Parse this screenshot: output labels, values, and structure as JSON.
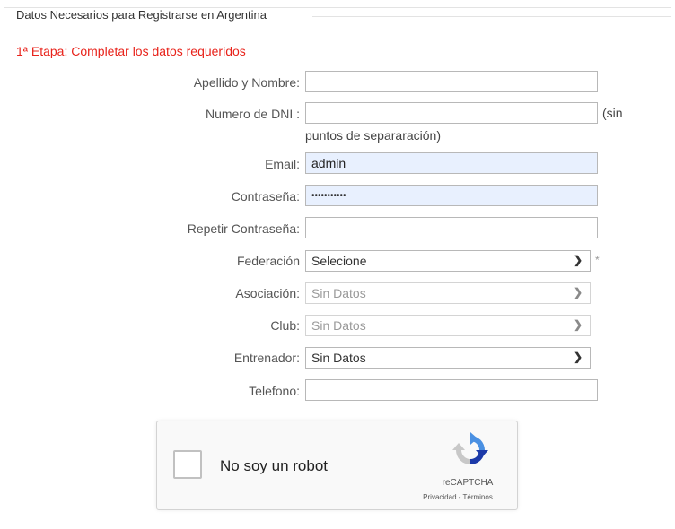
{
  "form": {
    "legend": "Datos Necesarios para Registrarse en Argentina",
    "stage_title": "1ª Etapa: Completar los datos  requeridos",
    "fields": {
      "apellido_nombre": {
        "label": "Apellido y Nombre:",
        "value": ""
      },
      "dni": {
        "label": "Numero de DNI :",
        "value": "",
        "hint_a": "(sin",
        "hint_b": "puntos de separaración)"
      },
      "email": {
        "label": "Email:",
        "value": "admin"
      },
      "contrasena": {
        "label": "Contraseña:",
        "value": "•••••••••••"
      },
      "repetir_contrasena": {
        "label": "Repetir Contraseña:",
        "value": ""
      },
      "federacion": {
        "label": "Federación",
        "selected": "Selecione",
        "required_mark": "*"
      },
      "asociacion": {
        "label": "Asociación:",
        "selected": "Sin Datos"
      },
      "club": {
        "label": "Club:",
        "selected": "Sin Datos"
      },
      "entrenador": {
        "label": "Entrenador:",
        "selected": "Sin Datos"
      },
      "telefono": {
        "label": "Telefono:",
        "value": ""
      }
    }
  },
  "recaptcha": {
    "label": "No soy un robot",
    "brand": "reCAPTCHA",
    "links": "Privacidad - Términos",
    "checked": false
  },
  "colors": {
    "stage_title": "#e8231b",
    "autofill_bg": "#e8f0fe"
  }
}
